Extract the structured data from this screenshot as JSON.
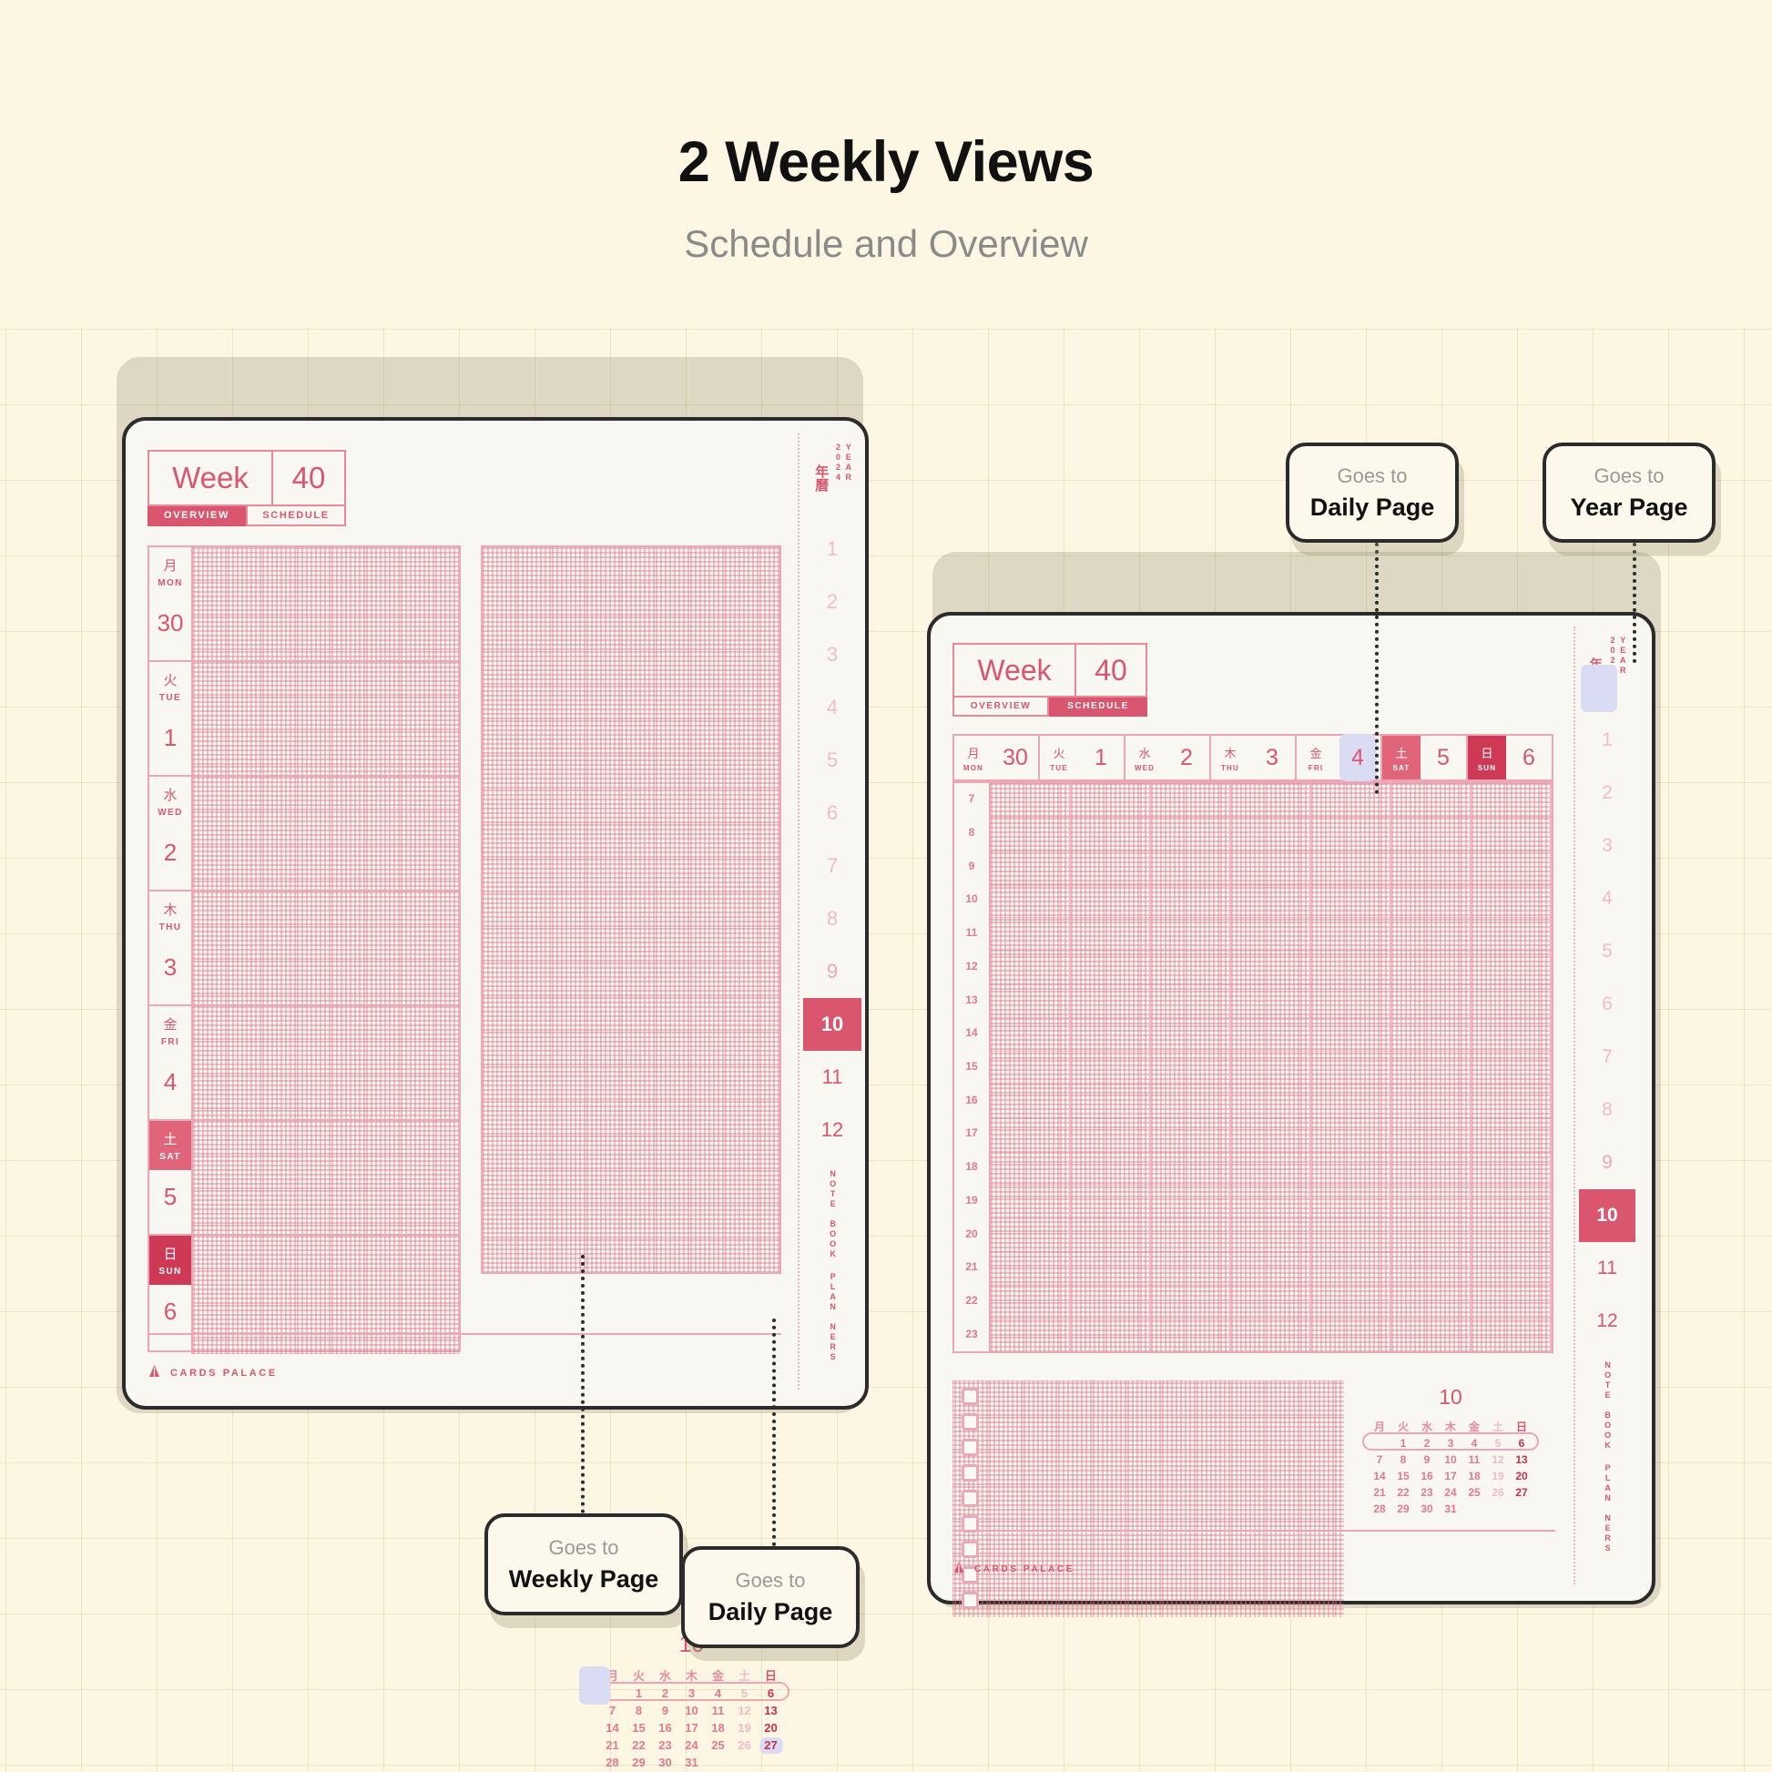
{
  "header": {
    "title": "2 Weekly Views",
    "subtitle": "Schedule and Overview"
  },
  "brand": {
    "name": "CARDS PALACE"
  },
  "rail": {
    "year_cjk": "年曆",
    "year_label": "YEAR",
    "year_number": "2024",
    "months": [
      "1",
      "2",
      "3",
      "4",
      "5",
      "6",
      "7",
      "8",
      "9",
      "10",
      "11",
      "12"
    ],
    "active_month": "10",
    "tag_note": "NOTE BOOK",
    "tag_plan": "PLAN NERS"
  },
  "overview_planner": {
    "week_label": "Week",
    "week_number": "40",
    "tab_overview": "OVERVIEW",
    "tab_schedule": "SCHEDULE",
    "active_tab": "OVERVIEW",
    "days": [
      {
        "kanji": "月",
        "abbr": "MON",
        "num": "30",
        "type": "weekday"
      },
      {
        "kanji": "火",
        "abbr": "TUE",
        "num": "1",
        "type": "weekday"
      },
      {
        "kanji": "水",
        "abbr": "WED",
        "num": "2",
        "type": "weekday"
      },
      {
        "kanji": "木",
        "abbr": "THU",
        "num": "3",
        "type": "weekday"
      },
      {
        "kanji": "金",
        "abbr": "FRI",
        "num": "4",
        "type": "weekday"
      },
      {
        "kanji": "土",
        "abbr": "SAT",
        "num": "5",
        "type": "sat"
      },
      {
        "kanji": "日",
        "abbr": "SUN",
        "num": "6",
        "type": "sun"
      }
    ]
  },
  "schedule_planner": {
    "week_label": "Week",
    "week_number": "40",
    "tab_overview": "OVERVIEW",
    "tab_schedule": "SCHEDULE",
    "active_tab": "SCHEDULE",
    "days": [
      {
        "kanji": "月",
        "abbr": "MON",
        "num": "30",
        "type": "weekday",
        "selected": false
      },
      {
        "kanji": "火",
        "abbr": "TUE",
        "num": "1",
        "type": "weekday",
        "selected": false
      },
      {
        "kanji": "水",
        "abbr": "WED",
        "num": "2",
        "type": "weekday",
        "selected": false
      },
      {
        "kanji": "木",
        "abbr": "THU",
        "num": "3",
        "type": "weekday",
        "selected": false
      },
      {
        "kanji": "金",
        "abbr": "FRI",
        "num": "4",
        "type": "weekday",
        "selected": true
      },
      {
        "kanji": "土",
        "abbr": "SAT",
        "num": "5",
        "type": "sat",
        "selected": false
      },
      {
        "kanji": "日",
        "abbr": "SUN",
        "num": "6",
        "type": "sun",
        "selected": false
      }
    ],
    "hours": [
      "7",
      "8",
      "9",
      "10",
      "11",
      "12",
      "13",
      "14",
      "15",
      "16",
      "17",
      "18",
      "19",
      "20",
      "21",
      "22",
      "23"
    ],
    "checkbox_count": 9
  },
  "mini_calendar": {
    "month": "10",
    "weekday_headers": [
      "月",
      "火",
      "水",
      "木",
      "金",
      "土",
      "日"
    ],
    "weeks": [
      [
        "",
        "1",
        "2",
        "3",
        "4",
        "5",
        "6"
      ],
      [
        "7",
        "8",
        "9",
        "10",
        "11",
        "12",
        "13"
      ],
      [
        "14",
        "15",
        "16",
        "17",
        "18",
        "19",
        "20"
      ],
      [
        "21",
        "22",
        "23",
        "24",
        "25",
        "26",
        "27"
      ],
      [
        "28",
        "29",
        "30",
        "31",
        "",
        "",
        ""
      ]
    ],
    "highlighted_week_index": 0,
    "selected_day_left": "27",
    "selected_day_right": null
  },
  "callouts": [
    {
      "id": "daily-top",
      "pre": "Goes to",
      "main": "Daily Page"
    },
    {
      "id": "year-top",
      "pre": "Goes to",
      "main": "Year Page"
    },
    {
      "id": "weekly-bot",
      "pre": "Goes to",
      "main": "Weekly Page"
    },
    {
      "id": "daily-bot",
      "pre": "Goes to",
      "main": "Daily Page"
    }
  ],
  "colors": {
    "background": "#fdf6e3",
    "accent_red": "#d9566e",
    "accent_light": "#eda6b4",
    "sat_red": "#e0657b",
    "sun_red": "#ce3a56",
    "selection_lavender": "#d9dcf2",
    "ink": "#2b2b2b",
    "muted": "#8a8a8a"
  }
}
